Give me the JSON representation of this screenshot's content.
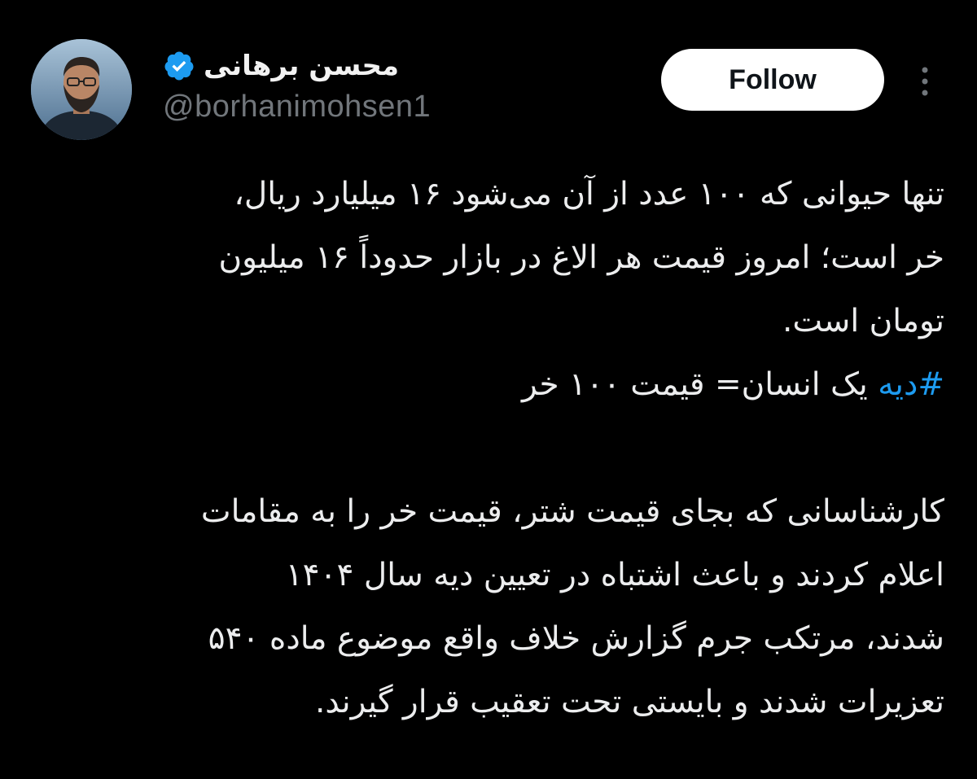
{
  "author": {
    "display_name": "محسن برهانی",
    "handle": "@borhanimohsen1",
    "verified": true,
    "verified_color": "#1d9bf0"
  },
  "actions": {
    "follow_label": "Follow",
    "more_icon": "more-vertical-icon"
  },
  "tweet": {
    "paragraph1": [
      "تنها حیوانی که ۱۰۰ عدد از آن می‌شود ۱۶ میلیارد ریال،",
      "خر است؛ امروز قیمت هر الاغ در بازار حدوداً ۱۶ میلیون",
      "تومان است."
    ],
    "hashtag": "#دیه",
    "hashtag_line_rest": " یک انسان= قیمت ۱۰۰ خر",
    "paragraph2": [
      "کارشناسانی که بجای قیمت شتر، قیمت خر را به مقامات",
      "اعلام کردند و باعث اشتباه در تعیین دیه سال ۱۴۰۴",
      "شدند، مرتکب جرم گزارش خلاف واقع موضوع ماده ۵۴۰",
      "تعزیرات شدند و بایستی تحت تعقیب قرار گیرند."
    ]
  },
  "colors": {
    "background": "#000000",
    "text": "#ecedee",
    "secondary_text": "#71767b",
    "link": "#1d9bf0",
    "follow_bg": "#ffffff"
  }
}
